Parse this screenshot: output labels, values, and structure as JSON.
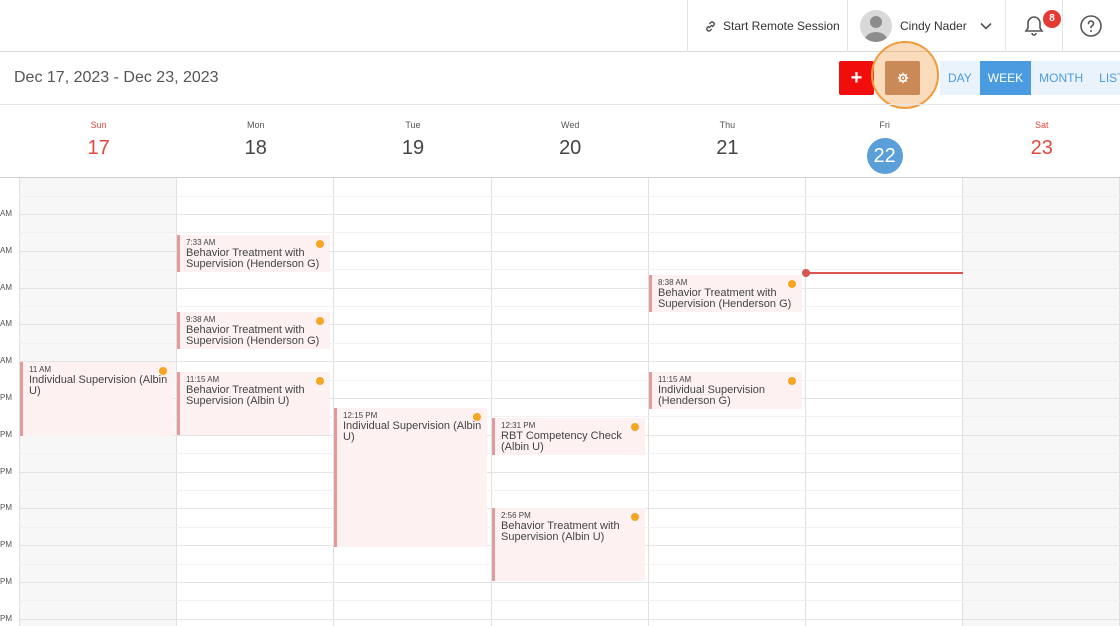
{
  "header": {
    "remote_session_label": "Start Remote Session",
    "user_name": "Cindy Nader",
    "notification_count": "8",
    "icons": {
      "link": "link-icon",
      "avatar": "user-avatar",
      "chevron": "chevron-down-icon",
      "bell": "bell-icon",
      "help": "help-circle-icon"
    }
  },
  "toolbar": {
    "date_range": "Dec 17, 2023 - Dec 23, 2023",
    "add_label": "+",
    "views": [
      "DAY",
      "WEEK",
      "MONTH",
      "LIST"
    ],
    "active_view": "WEEK",
    "colors": {
      "add": "#f20d0d",
      "settings": "#c98a57",
      "view_accent": "#4a9be0",
      "highlight_ring": "#f09a3e"
    }
  },
  "days": [
    {
      "name": "Sun",
      "num": "17",
      "weekend": true
    },
    {
      "name": "Mon",
      "num": "18",
      "weekend": false
    },
    {
      "name": "Tue",
      "num": "19",
      "weekend": false
    },
    {
      "name": "Wed",
      "num": "20",
      "weekend": false
    },
    {
      "name": "Thu",
      "num": "21",
      "weekend": false
    },
    {
      "name": "Fri",
      "num": "22",
      "weekend": false,
      "today": true
    },
    {
      "name": "Sat",
      "num": "23",
      "weekend": true
    }
  ],
  "time_labels": [
    "AM",
    "AM",
    "AM",
    "AM",
    "AM",
    "PM",
    "PM",
    "PM",
    "PM",
    "PM",
    "PM",
    "PM"
  ],
  "events": [
    {
      "day": "Sun",
      "time": "11 AM",
      "title": "Individual Supervision (Albin U)"
    },
    {
      "day": "Mon",
      "time": "7:33 AM",
      "title": "Behavior Treatment with Supervision (Henderson G)"
    },
    {
      "day": "Mon",
      "time": "9:38 AM",
      "title": "Behavior Treatment with Supervision (Henderson G)"
    },
    {
      "day": "Mon",
      "time": "11:15 AM",
      "title": "Behavior Treatment with Supervision (Albin U)"
    },
    {
      "day": "Tue",
      "time": "12:15 PM",
      "title": "Individual Supervision (Albin U)"
    },
    {
      "day": "Wed",
      "time": "12:31 PM",
      "title": "RBT Competency Check (Albin U)"
    },
    {
      "day": "Wed",
      "time": "2:56 PM",
      "title": "Behavior Treatment with Supervision (Albin U)"
    },
    {
      "day": "Thu",
      "time": "8:38 AM",
      "title": "Behavior Treatment with Supervision (Henderson G)"
    },
    {
      "day": "Thu",
      "time": "11:15 AM",
      "title": "Individual Supervision (Henderson G)"
    }
  ],
  "event_colors": {
    "background": "#fdf1f1",
    "border": "#e29a9a",
    "status_dot": "#f5a623",
    "now_line": "#d9534f"
  }
}
